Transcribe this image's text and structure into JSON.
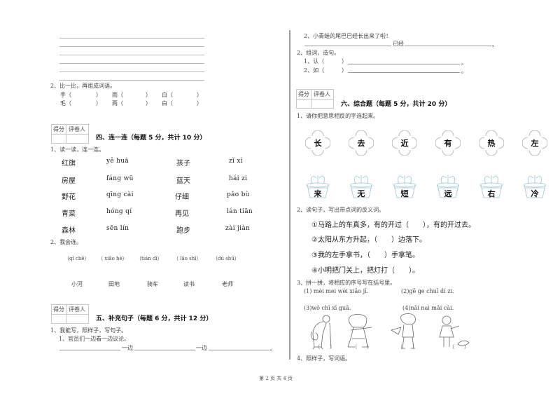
{
  "left": {
    "writing_lines_count": 6,
    "q2_compare": {
      "label": "2、比一比，再组成词语。",
      "rows": [
        [
          "手（",
          "）",
          "雨（",
          "）",
          "白（",
          "）"
        ],
        [
          "毛（",
          "）",
          "两（",
          "）",
          "白（",
          "）"
        ]
      ]
    },
    "section4": {
      "score_box": {
        "score": "得分",
        "grader": "评卷人"
      },
      "title": "四、连一连（每题 5 分，共计 10 分）",
      "q1_label": "1、读一读，连一连。",
      "pairs": [
        {
          "word1": "红旗",
          "pinyin1": "yě  huā",
          "word2": "孩子",
          "pinyin2": "zǐ  xì"
        },
        {
          "word1": "房屋",
          "pinyin1": "fáng  wū",
          "word2": "蓝天",
          "pinyin2": "hái  zi"
        },
        {
          "word1": "野花",
          "pinyin1": "qīng  cài",
          "word2": "仔细",
          "pinyin2": "pǎo  bù"
        },
        {
          "word1": "青菜",
          "pinyin1": "hóng  qí",
          "word2": "再见",
          "pinyin2": "lán  tiān"
        },
        {
          "word1": "森林",
          "pinyin1": "sēn  lín",
          "word2": "跑步",
          "pinyin2": "zài  jiàn"
        }
      ],
      "q2_label": "2、我会连。",
      "pinyin_row": [
        "（qí chē）",
        "（ xiǎo hé）",
        "（tián dì）",
        "（ lǎo shī）",
        "（dú shū）"
      ],
      "word_row": [
        "小河",
        "田地",
        "骑车",
        "读书",
        "老师"
      ]
    },
    "section5": {
      "score_box": {
        "score": "得分",
        "grader": "评卷人"
      },
      "title": "五、补充句子（每题 6 分，共计 12 分）",
      "q1_label": "1、我能写，照样子，写句子。",
      "example": "1、官员们一边看一边议论。",
      "fill": [
        "一边",
        "一边",
        "。"
      ]
    }
  },
  "right": {
    "q2_sentence": "2、小青蛙的尾巴已经长出来了啦！",
    "q2_fill": [
      "已经",
      "。"
    ],
    "q_zuci": {
      "label": "2、组词，造句。",
      "items": [
        {
          "prefix": "1、认（",
          "close": "）",
          "end": "。"
        },
        {
          "prefix": "2、如（",
          "close": "）",
          "end": "。"
        }
      ]
    },
    "section6": {
      "score_box": {
        "score": "得分",
        "grader": "评卷人"
      },
      "title": "六、综合题（每题 5 分，共计 20 分）",
      "q1_label": "1、请你把意思相反的字连起来。",
      "flowers": [
        "长",
        "去",
        "近",
        "有",
        "热",
        "左"
      ],
      "pots": [
        "来",
        "无",
        "短",
        "远",
        "右",
        "冷"
      ],
      "q2_label": "2、读句子，写出带点词的反义词。",
      "sentences": [
        "①马路上的车真多，有的开过（　　），有的开过去。",
        "②太阳从东方升起，（　　）边落下。",
        "③我的左手拿书，（　　）手拿笔。",
        "④小明把门关上，把灯打（　　）。"
      ],
      "q3_label": "3、拼一拼，将相应的序号写在括号里。",
      "pinyin_items": [
        "(1) mèi  mei  wèi  xiǎo  jī.",
        "(2)gē  ge  chuī  dí  zi.",
        "(3)wǒ chī  xī  guā.",
        "(4)nǎi  nai  mǎi  cài."
      ],
      "figure_parens": [
        "（　　）",
        "（　　）",
        "（　　）",
        "（　　）"
      ],
      "q4_label": "4、照样子，写词语。"
    }
  },
  "footer": {
    "page_text": "第 2 页 共 4 页"
  }
}
